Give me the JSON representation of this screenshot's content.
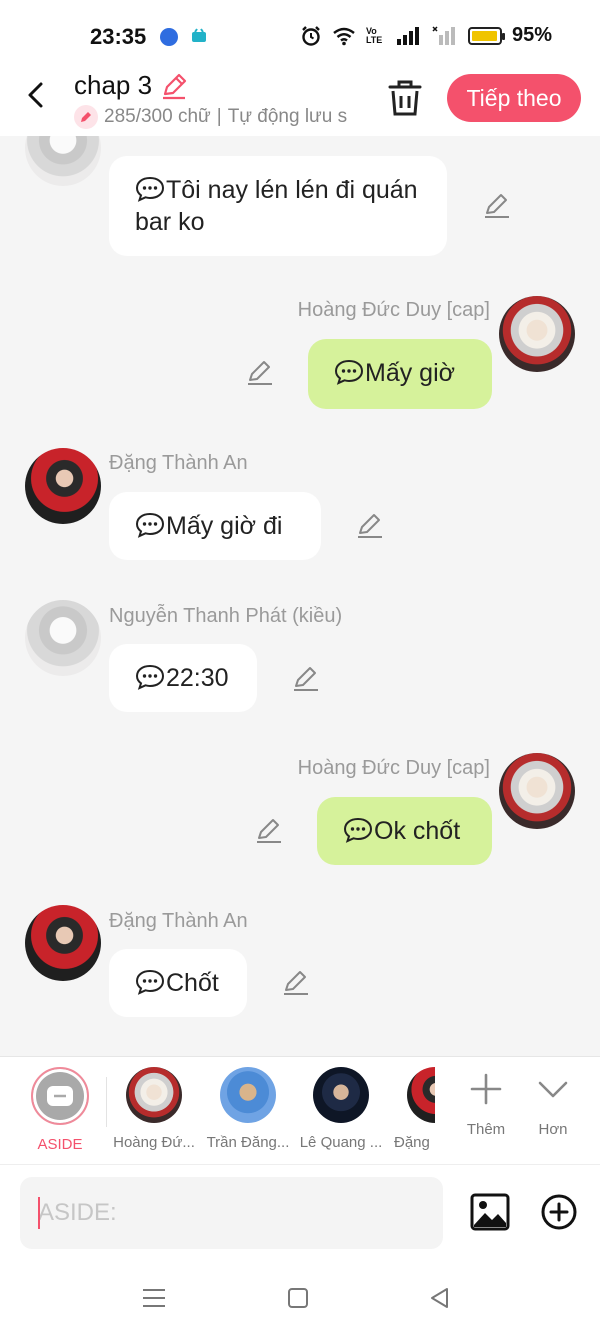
{
  "status_bar": {
    "time": "23:35",
    "battery_pct": "95%",
    "battery_level": 0.95,
    "network_label": "Vo LTE"
  },
  "header": {
    "title": "chap 3",
    "counter": "285/300 chữ",
    "autosave": "Tự động lưu s",
    "next_label": "Tiếp theo"
  },
  "colors": {
    "accent": "#f4516c",
    "bubble_right": "#d6f29b",
    "bubble_left": "#ffffff"
  },
  "messages": [
    {
      "side": "left",
      "sender": "",
      "text": "Tôi nay lén lén đi quán bar ko",
      "avatar": "avatar-phat"
    },
    {
      "side": "right",
      "sender": "Hoàng Đức Duy [cap]",
      "text": "Mấy giờ",
      "avatar": "avatar-duy"
    },
    {
      "side": "left",
      "sender": "Đặng Thành An",
      "text": "Mấy giờ đi",
      "avatar": "avatar-an"
    },
    {
      "side": "left",
      "sender": "Nguyễn Thanh Phát (kiều)",
      "text": "22:30",
      "avatar": "avatar-phat"
    },
    {
      "side": "right",
      "sender": "Hoàng Đức Duy [cap]",
      "text": "Ok chốt",
      "avatar": "avatar-duy"
    },
    {
      "side": "left",
      "sender": "Đặng Thành An",
      "text": "Chốt",
      "avatar": "avatar-an"
    }
  ],
  "characters": [
    {
      "name": "ASIDE"
    },
    {
      "name": "Hoàng Đứ..."
    },
    {
      "name": "Trần Đăng..."
    },
    {
      "name": "Lê Quang ..."
    },
    {
      "name": "Đặng"
    },
    {
      "name": "Thêm"
    },
    {
      "name": "Hơn"
    }
  ],
  "input": {
    "placeholder": "ASIDE:"
  }
}
